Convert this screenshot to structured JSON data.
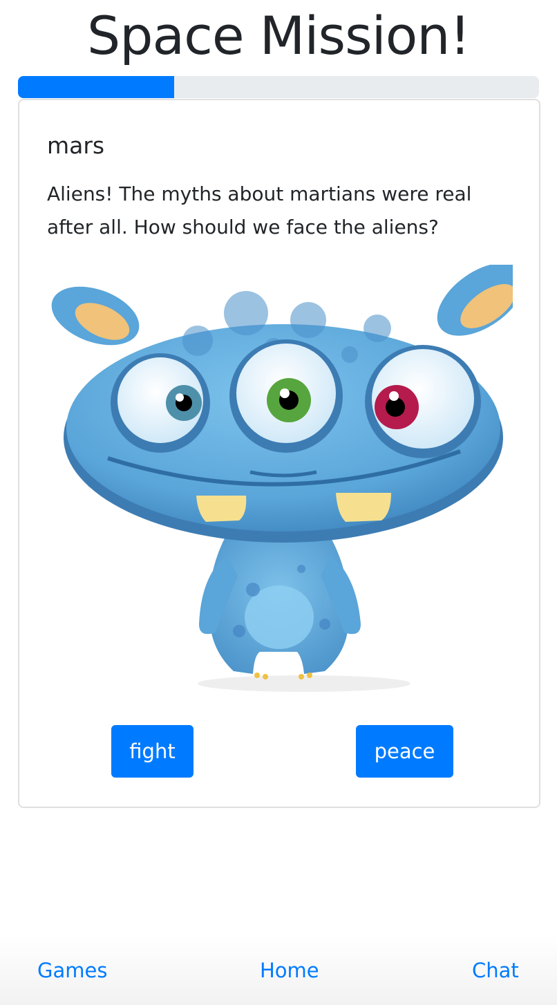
{
  "header": {
    "title": "Space Mission!"
  },
  "progress": {
    "value_percent": 30,
    "color": "#007bff"
  },
  "card": {
    "title": "mars",
    "text": "Aliens! The myths about martians were real after all. How should we face the aliens?",
    "image": {
      "icon": "blue-three-eyed-alien-icon"
    },
    "buttons": {
      "fight": "fight",
      "peace": "peace"
    }
  },
  "nav": {
    "games": "Games",
    "home": "Home",
    "chat": "Chat"
  },
  "colors": {
    "accent": "#007bff",
    "alien_body": "#5aa5d9",
    "alien_ears": "#f0c27a"
  }
}
